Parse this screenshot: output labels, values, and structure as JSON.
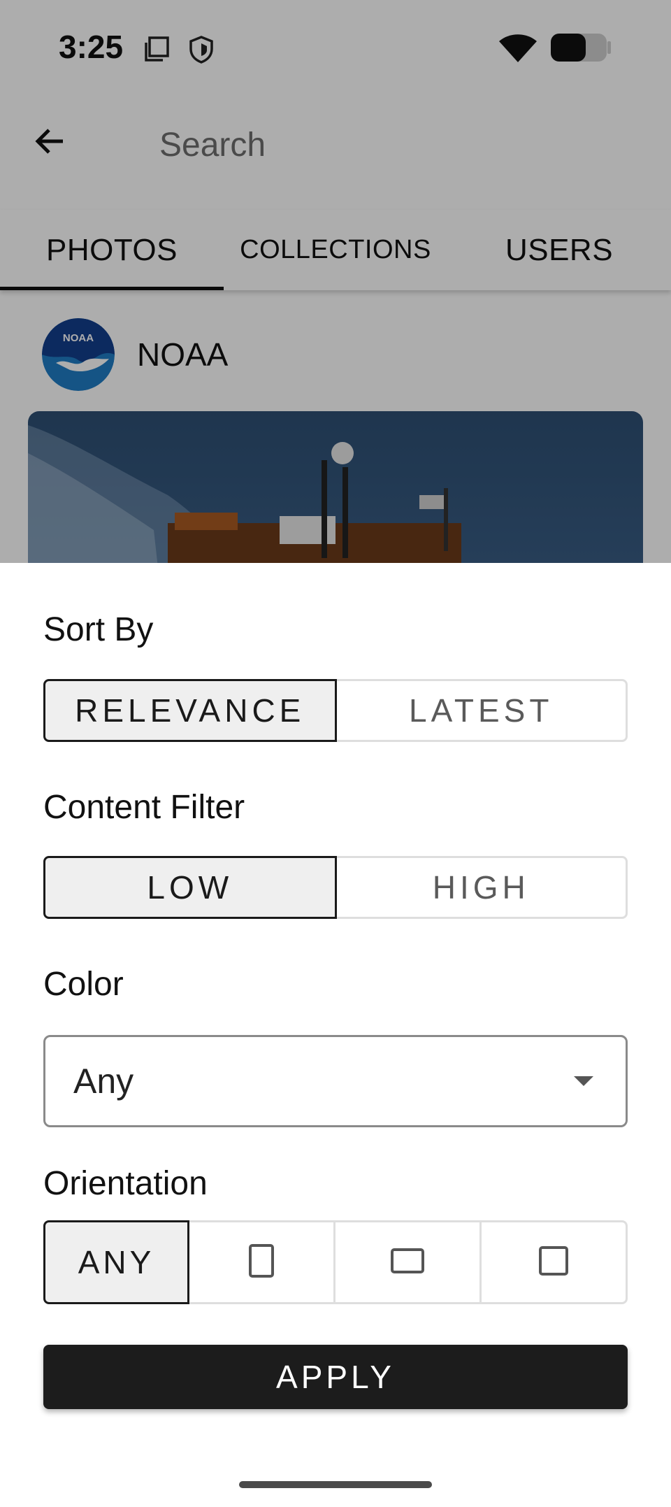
{
  "status_bar": {
    "time": "3:25",
    "icons": [
      "sim-card-icon",
      "shield-icon",
      "wifi-icon",
      "battery-icon"
    ]
  },
  "search": {
    "placeholder": "Search"
  },
  "tabs": [
    {
      "label": "PHOTOS",
      "selected": true
    },
    {
      "label": "COLLECTIONS",
      "selected": false
    },
    {
      "label": "USERS",
      "selected": false
    }
  ],
  "result": {
    "user_name": "NOAA",
    "avatar_text": "NOAA"
  },
  "filter_sheet": {
    "sort_by": {
      "label": "Sort By",
      "options": [
        "RELEVANCE",
        "LATEST"
      ],
      "selected": "RELEVANCE"
    },
    "content_filter": {
      "label": "Content Filter",
      "options": [
        "LOW",
        "HIGH"
      ],
      "selected": "LOW"
    },
    "color": {
      "label": "Color",
      "value": "Any"
    },
    "orientation": {
      "label": "Orientation",
      "options": [
        "ANY",
        "portrait-icon",
        "landscape-icon",
        "square-icon"
      ],
      "selected": "ANY",
      "any_label": "ANY"
    },
    "apply_label": "APPLY"
  },
  "colors": {
    "scrim": "#000000",
    "apply_background": "#1c1c1c",
    "selected_segment": "#efefef"
  }
}
